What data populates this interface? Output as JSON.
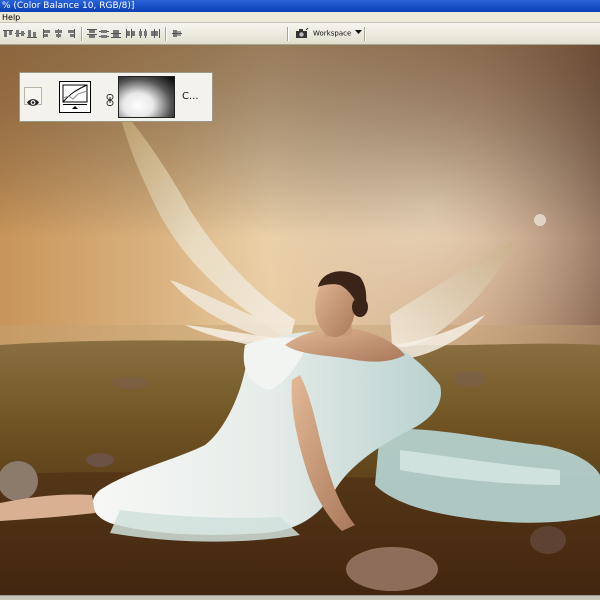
{
  "window": {
    "title": "% (Color Balance 10, RGB/8)]"
  },
  "menu": {
    "items": [
      "Help"
    ]
  },
  "toolbar": {
    "workspace_label": "Workspace",
    "workspace_icon": "chevron-down-icon"
  },
  "layer": {
    "name": "C...",
    "visible_icon": "eye-icon",
    "adjustment_icon": "curves-adjustment-icon",
    "link_icon": "chain-link-icon"
  },
  "colors": {
    "titlebar": "#0b3fb4",
    "toolbar": "#ece9d8"
  }
}
